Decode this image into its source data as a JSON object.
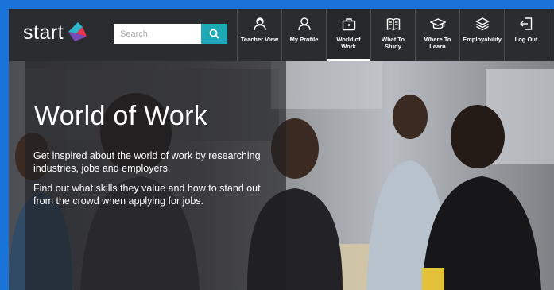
{
  "brand": {
    "logo_text": "start"
  },
  "search": {
    "placeholder": "Search"
  },
  "nav": {
    "items": [
      {
        "label": "Teacher View",
        "icon": "teacher-icon"
      },
      {
        "label": "My Profile",
        "icon": "profile-icon"
      },
      {
        "label": "World of\nWork",
        "icon": "briefcase-icon",
        "active": true
      },
      {
        "label": "What To\nStudy",
        "icon": "book-icon"
      },
      {
        "label": "Where To\nLearn",
        "icon": "graduation-cap-icon"
      },
      {
        "label": "Employability",
        "icon": "layers-icon"
      },
      {
        "label": "Log Out",
        "icon": "logout-icon"
      }
    ]
  },
  "hero": {
    "title": "World of Work",
    "paragraph1": "Get inspired about the world of work by researching industries, jobs and employers.",
    "paragraph2": "Find out what skills they value and how to stand out from the crowd when applying for jobs."
  },
  "colors": {
    "page_border": "#1a73d9",
    "topbar": "#2b2c30",
    "search_button": "#1fa9b7",
    "logo_teal": "#2bb5c8",
    "logo_red": "#e8364f",
    "logo_purple": "#7a4bb5"
  }
}
